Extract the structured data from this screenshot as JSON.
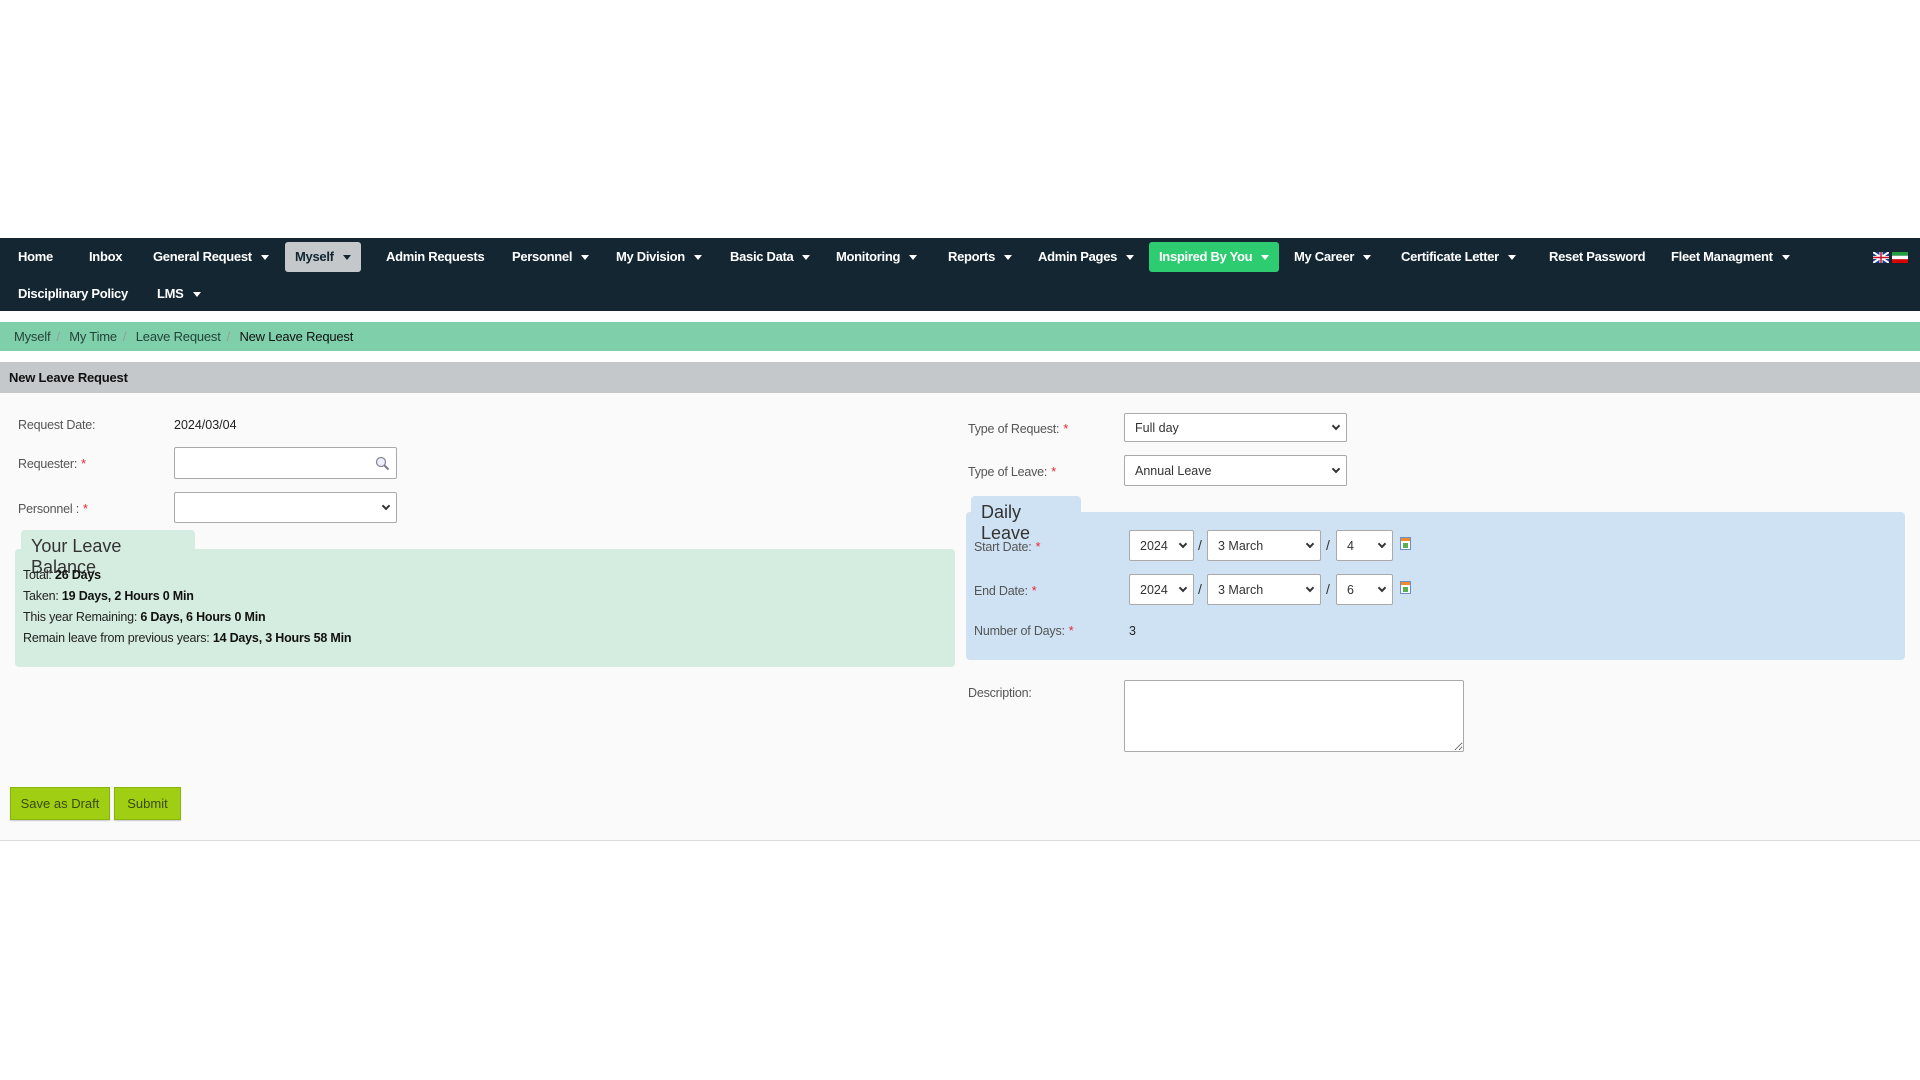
{
  "nav": {
    "items": [
      {
        "label": "Home",
        "dropdown": false
      },
      {
        "label": "Inbox",
        "dropdown": false
      },
      {
        "label": "General Request",
        "dropdown": true
      },
      {
        "label": "Myself",
        "dropdown": true,
        "active": true
      },
      {
        "label": "Admin Requests",
        "dropdown": false
      },
      {
        "label": "Personnel",
        "dropdown": true
      },
      {
        "label": "My Division",
        "dropdown": true
      },
      {
        "label": "Basic Data",
        "dropdown": true
      },
      {
        "label": "Monitoring",
        "dropdown": true
      },
      {
        "label": "Reports",
        "dropdown": true
      },
      {
        "label": "Admin Pages",
        "dropdown": true
      },
      {
        "label": "Inspired By You",
        "dropdown": true,
        "highlight": "#2ecc71"
      },
      {
        "label": "My Career",
        "dropdown": true
      },
      {
        "label": "Certificate Letter",
        "dropdown": true
      },
      {
        "label": "Reset Password",
        "dropdown": false
      },
      {
        "label": "Fleet Managment",
        "dropdown": true
      },
      {
        "label": "Disciplinary Policy",
        "dropdown": false
      },
      {
        "label": "LMS",
        "dropdown": true
      }
    ],
    "language_flags": [
      "uk-flag-icon",
      "iran-flag-icon"
    ]
  },
  "breadcrumb": [
    "Myself",
    "My Time",
    "Leave Request",
    "New Leave Request"
  ],
  "page_title": "New Leave Request",
  "form": {
    "request_date_label": "Request Date:",
    "request_date_value": "2024/03/04",
    "requester_label": "Requester:",
    "requester_value": "",
    "personnel_label": "Personnel :",
    "personnel_value": "",
    "type_of_request_label": "Type of Request:",
    "type_of_request_value": "Full day",
    "type_of_leave_label": "Type of Leave:",
    "type_of_leave_value": "Annual Leave",
    "description_label": "Description:",
    "description_value": "",
    "required_mark": "*"
  },
  "balance": {
    "title": "Your Leave Balance",
    "rows": [
      {
        "label": "Total:",
        "value": "26 Days"
      },
      {
        "label": "Taken:",
        "value": "19 Days, 2 Hours 0 Min"
      },
      {
        "label": "This year Remaining:",
        "value": "6 Days, 6 Hours 0 Min"
      },
      {
        "label": "Remain leave from previous years:",
        "value": "14 Days, 3 Hours 58 Min"
      }
    ]
  },
  "daily_leave": {
    "title": "Daily Leave",
    "start_label": "Start Date:",
    "start": {
      "year": "2024",
      "month": "3 March",
      "day": "4"
    },
    "end_label": "End Date:",
    "end": {
      "year": "2024",
      "month": "3 March",
      "day": "6"
    },
    "days_label": "Number of Days:",
    "days_value": "3",
    "separator": "/"
  },
  "buttons": {
    "save_draft": "Save as Draft",
    "submit": "Submit"
  },
  "colors": {
    "navbar": "#132632",
    "breadcrumb": "#7fcfaa",
    "balance_box": "#d5ede0",
    "daily_box": "#cfe2f3",
    "button": "#9fce12",
    "active_nav": "#2ecc71"
  }
}
